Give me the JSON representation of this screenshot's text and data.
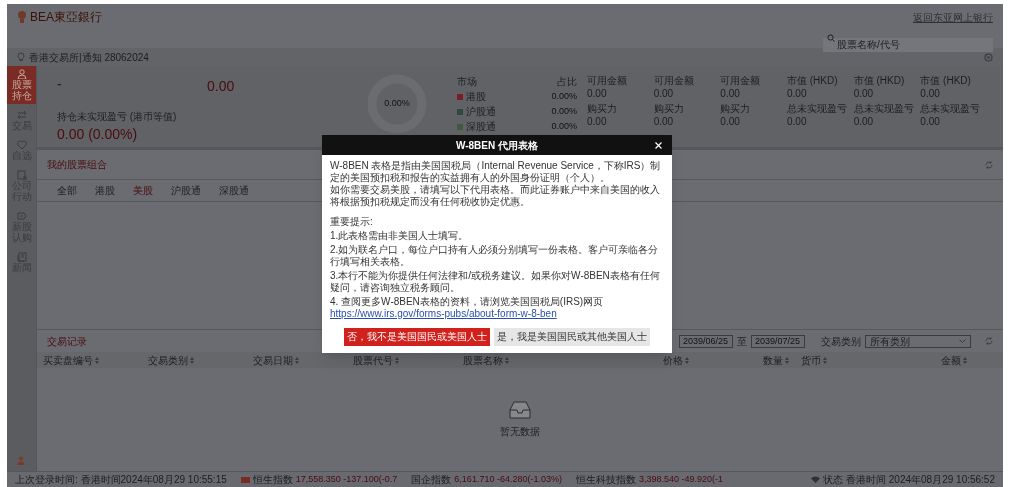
{
  "header": {
    "logo_text": "BEA東亞銀行",
    "back_link": "返回东亚网上银行",
    "search": {
      "placeholder": "股票名称/代号"
    }
  },
  "notice": {
    "text": "香港交易所|通知 28062024"
  },
  "sidebar": {
    "items": [
      {
        "label": "股票持仓",
        "selected": true
      },
      {
        "label": "交易",
        "selected": false
      },
      {
        "label": "自选",
        "selected": false
      },
      {
        "label": "公司行动",
        "selected": false
      },
      {
        "label": "新股认购",
        "selected": false
      },
      {
        "label": "新闻",
        "selected": false
      }
    ]
  },
  "summary": {
    "value_1": "-",
    "value_2": "0.00",
    "unrealized_label": "持仓未实现盈亏 (港币等值)",
    "unrealized_value": "0.00 (0.00%)",
    "donut_label": "0.00%",
    "legend_header": [
      "市场",
      "占比"
    ],
    "legend": [
      {
        "label": "港股",
        "share": "0.00%",
        "color": "#7a1c2a"
      },
      {
        "label": "沪股通",
        "share": "0.00%",
        "color": "#2f4a3a"
      },
      {
        "label": "深股通",
        "share": "0.00%",
        "color": "#3f5a40"
      }
    ],
    "metrics": [
      {
        "label": "可用金额",
        "value": "0.00",
        "label_2": "购买力",
        "value_2": "0.00"
      },
      {
        "label": "可用金额",
        "value": "0.00",
        "label_2": "购买力",
        "value_2": "0.00"
      },
      {
        "label": "可用金额",
        "value": "0.00",
        "label_2": "购买力",
        "value_2": "0.00"
      },
      {
        "label": "市值 (HKD)",
        "value": "0.00",
        "label_2": "总未实现盈亏",
        "value_2": "0.00"
      },
      {
        "label": "市值 (HKD)",
        "value": "0.00",
        "label_2": "总未实现盈亏",
        "value_2": "0.00"
      },
      {
        "label": "市值 (HKD)",
        "value": "0.00",
        "label_2": "总未实现盈亏",
        "value_2": "0.00"
      }
    ]
  },
  "portfolio": {
    "title": "我的股票组合",
    "tabs": [
      {
        "label": "全部",
        "selected": false
      },
      {
        "label": "港股",
        "selected": false
      },
      {
        "label": "美股",
        "selected": true
      },
      {
        "label": "沪股通",
        "selected": false
      },
      {
        "label": "深股通",
        "selected": false
      }
    ]
  },
  "trades": {
    "title": "交易记录",
    "date_from": "2039/06/25",
    "date_to_label": "至",
    "date_to": "2039/07/25",
    "category_label": "交易类别",
    "category": "所有类别",
    "columns": [
      "买卖盘编号",
      "交易类别",
      "交易日期",
      "股票代号",
      "股票名称",
      "价格",
      "数量",
      "货币",
      "金额"
    ],
    "empty_text": "暂无数据"
  },
  "status_bar": {
    "last_login": "上次登录时间: 香港时间2024年08月29 10:55:15",
    "indices": [
      {
        "name": "恒生指数",
        "value": "17,558.350 -137.100(-0.7"
      },
      {
        "name": "国企指数",
        "value": "6,161.710 -64.280(-1.03%)"
      },
      {
        "name": "恒生科技指数",
        "value": "3,398.540 -49.920(-1"
      }
    ],
    "status_label": "状态",
    "time": "香港时间 2024年08月29 10:56:52"
  },
  "dialog": {
    "title": "W-8BEN 代用表格",
    "paragraphs": [
      "W-8BEN 表格是指由美国国税局（Internal Revenue Service，下称IRS）制定的美国预扣税和报告的实益拥有人的外国身份证明（个人）。",
      "如你需要交易美股，请填写以下代用表格。而此证券账户中来自美国的收入将根据预扣税规定而没有任何税收协定优惠。"
    ],
    "notes_title": "重要提示:",
    "notes": [
      "1.此表格需由非美国人士填写。",
      "2.如为联名户口，每位户口持有人必须分别填写一份表格。客户可亲临各分行填写相关表格。",
      "3.本行不能为你提供任何法律和/或税务建议。如果你对W-8BEN表格有任何疑问，请咨询独立税务顾问。",
      "4. 查阅更多W-8BEN表格的资料，请浏览美国国税局(IRS)网页"
    ],
    "link": "https://www.irs.gov/forms-pubs/about-form-w-8-ben",
    "buttons": [
      {
        "label": "否，我不是美国国民或美国人士",
        "kind": "primary"
      },
      {
        "label": "是，我是美国国民或其他美国人士",
        "kind": "secondary"
      }
    ]
  }
}
